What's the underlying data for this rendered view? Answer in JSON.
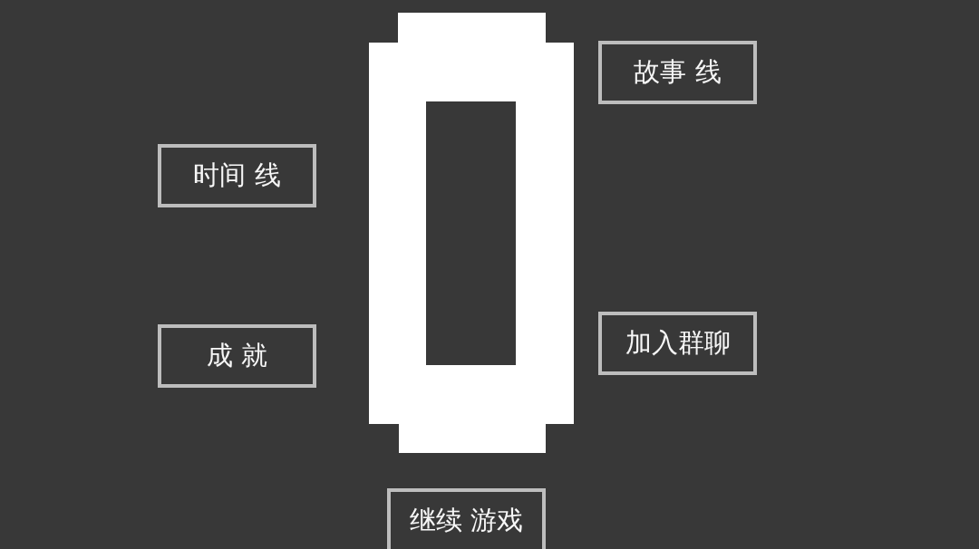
{
  "menu": {
    "left_buttons": [
      {
        "label": "时间 线"
      },
      {
        "label": "成 就"
      }
    ],
    "right_buttons": [
      {
        "label": "故事 线"
      },
      {
        "label": "加入群聊"
      }
    ],
    "bottom_button": {
      "label": "继续 游戏"
    }
  }
}
